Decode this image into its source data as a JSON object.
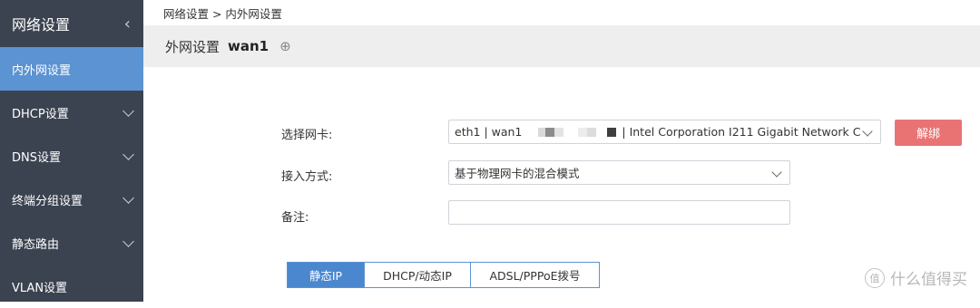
{
  "sidebar": {
    "title": "网络设置",
    "collapse_icon": "‹",
    "items": [
      {
        "label": "内外网设置",
        "active": true
      },
      {
        "label": "DHCP设置"
      },
      {
        "label": "DNS设置"
      },
      {
        "label": "终端分组设置"
      },
      {
        "label": "静态路由"
      },
      {
        "label": "VLAN设置"
      }
    ]
  },
  "breadcrumb": "网络设置 > 内外网设置",
  "header": {
    "title": "外网设置",
    "name": "wan1",
    "add_icon": "⊕"
  },
  "form": {
    "nic_label": "选择网卡:",
    "nic_value_prefix": "eth1 | wan1",
    "nic_value_suffix": "| Intel Corporation I211 Gigabit Network C",
    "unbind_label": "解绑",
    "access_label": "接入方式:",
    "access_value": "基于物理网卡的混合模式",
    "remark_label": "备注:",
    "remark_value": ""
  },
  "tabs": [
    {
      "label": "静态IP",
      "active": true
    },
    {
      "label": "DHCP/动态IP"
    },
    {
      "label": "ADSL/PPPoE拨号"
    }
  ],
  "watermark": {
    "icon": "值",
    "text": "什么值得买"
  },
  "colors": {
    "sidebar_bg": "#3b4350",
    "active": "#5b93d3",
    "danger": "#e97373"
  }
}
